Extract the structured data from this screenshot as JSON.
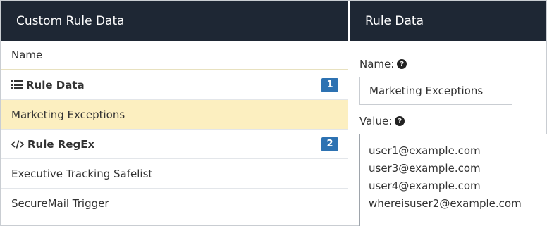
{
  "left_panel": {
    "title": "Custom Rule Data",
    "column_header": "Name",
    "rows": [
      {
        "label": "Rule Data",
        "type": "group",
        "icon": "list-icon",
        "badge": "1"
      },
      {
        "label": "Marketing Exceptions",
        "type": "item",
        "selected": true
      },
      {
        "label": "Rule RegEx",
        "type": "group",
        "icon": "code-icon",
        "badge": "2"
      },
      {
        "label": "Executive Tracking Safelist",
        "type": "item"
      },
      {
        "label": "SecureMail Trigger",
        "type": "item"
      }
    ]
  },
  "right_panel": {
    "title": "Rule Data",
    "name_label": "Name:",
    "name_value": "Marketing Exceptions",
    "value_label": "Value:",
    "value_lines": [
      "user1@example.com",
      "user3@example.com",
      "user4@example.com",
      "whereisuser2@example.com"
    ],
    "help_icon": "question-circle-icon"
  },
  "colors": {
    "header_bg": "#1e2734",
    "selected_row_bg": "#fcefc0",
    "badge_bg": "#2d72b2"
  }
}
